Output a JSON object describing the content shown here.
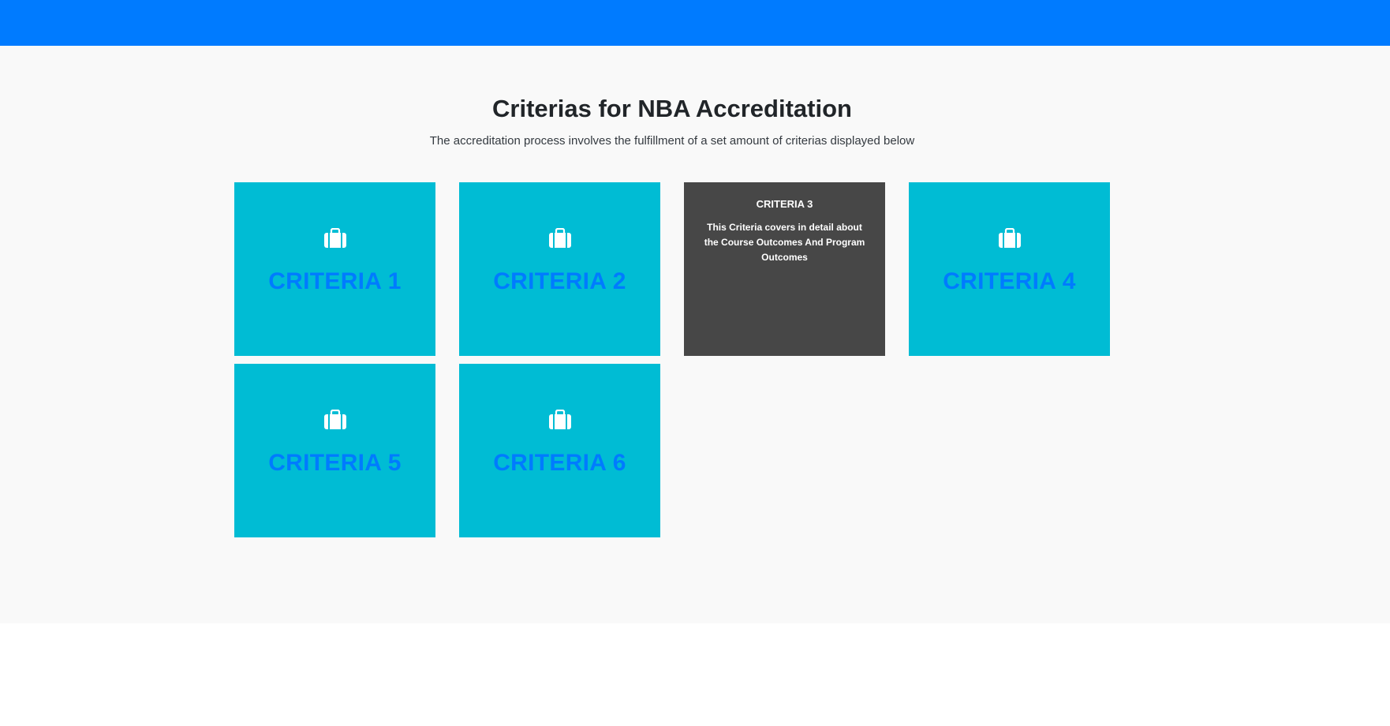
{
  "section": {
    "title": "Criterias for NBA Accreditation",
    "subtitle": "The accreditation process involves the fulfillment of a set amount of criterias displayed below"
  },
  "criteria": [
    {
      "label": "CRITERIA 1",
      "icon": "briefcase-icon"
    },
    {
      "label": "CRITERIA 2",
      "icon": "briefcase-icon"
    },
    {
      "label": "CRITERIA 3",
      "description": "This Criteria covers in detail about the Course Outcomes And Program Outcomes",
      "state": "hovered"
    },
    {
      "label": "CRITERIA 4",
      "icon": "briefcase-icon"
    },
    {
      "label": "CRITERIA 5",
      "icon": "briefcase-icon"
    },
    {
      "label": "CRITERIA 6",
      "icon": "briefcase-icon"
    }
  ],
  "colors": {
    "topbar": "#007bff",
    "card": "#00bcd4",
    "card_active": "#474747",
    "card_label": "#007bff",
    "section_bg": "#f9f9f9"
  }
}
